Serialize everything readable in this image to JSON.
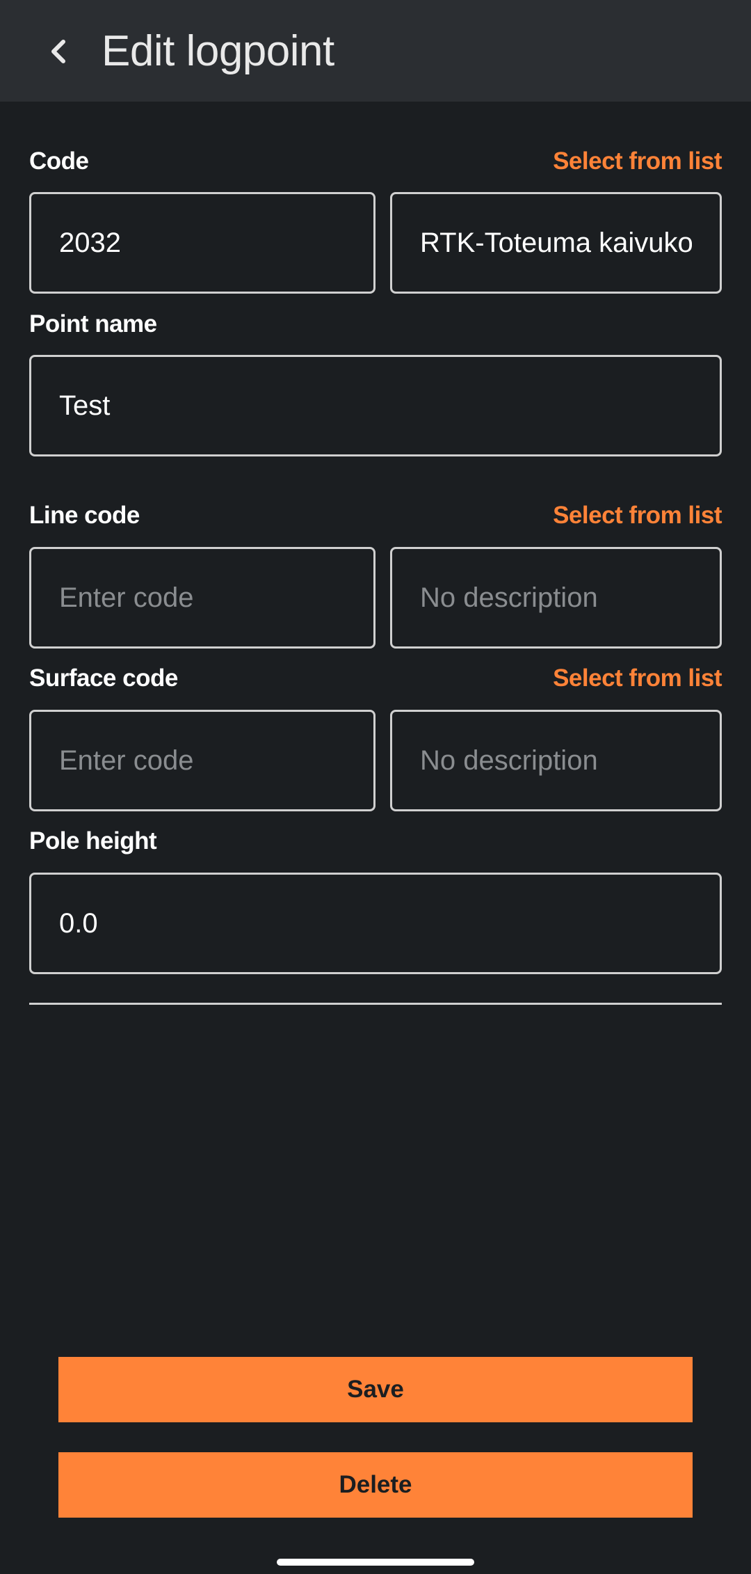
{
  "header": {
    "title": "Edit logpoint",
    "back_icon": "chevron-left-icon"
  },
  "code": {
    "label": "Code",
    "select_link": "Select from list",
    "value": "2032",
    "description": "RTK-Toteuma kaivukor"
  },
  "point_name": {
    "label": "Point name",
    "value": "Test"
  },
  "line_code": {
    "label": "Line code",
    "select_link": "Select from list",
    "code_placeholder": "Enter code",
    "description_placeholder": "No description"
  },
  "surface_code": {
    "label": "Surface code",
    "select_link": "Select from list",
    "code_placeholder": "Enter code",
    "description_placeholder": "No description"
  },
  "pole_height": {
    "label": "Pole height",
    "value": "0.0"
  },
  "actions": {
    "save_label": "Save",
    "delete_label": "Delete"
  },
  "colors": {
    "accent": "#ff8338",
    "background": "#1b1e21",
    "header_bg": "#2b2e32"
  }
}
